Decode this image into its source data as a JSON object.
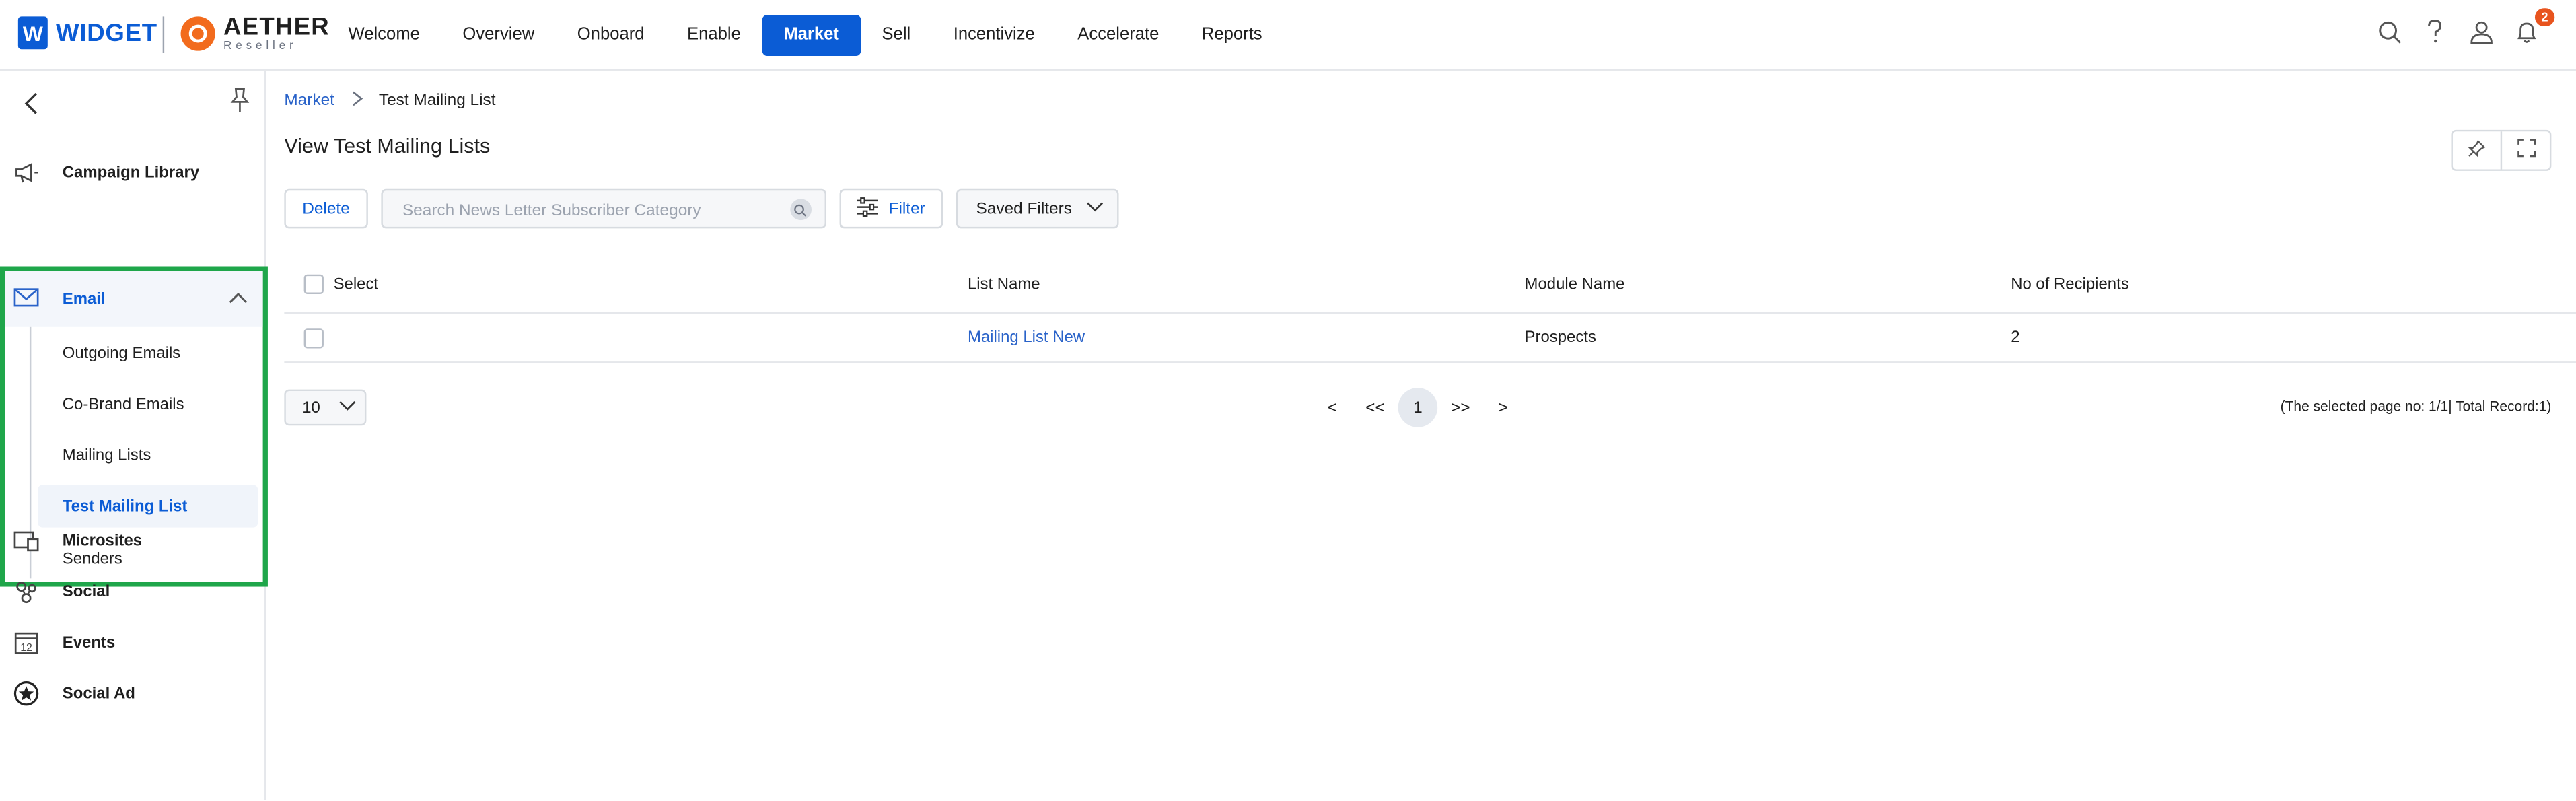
{
  "brand": {
    "widget_logo": "W",
    "widget_name": "WIDGET",
    "aether_name": "AETHER",
    "aether_sub": "Reseller"
  },
  "nav": [
    {
      "label": "Welcome"
    },
    {
      "label": "Overview"
    },
    {
      "label": "Onboard"
    },
    {
      "label": "Enable"
    },
    {
      "label": "Market"
    },
    {
      "label": "Sell"
    },
    {
      "label": "Incentivize"
    },
    {
      "label": "Accelerate"
    },
    {
      "label": "Reports"
    }
  ],
  "header_icons": {
    "notifications_count": "2"
  },
  "sidebar": {
    "items": [
      {
        "label": "Campaign Library",
        "icon": "megaphone-icon"
      },
      {
        "label": "Email",
        "icon": "envelope-icon"
      },
      {
        "label": "Microsites",
        "icon": "microsites-icon"
      },
      {
        "label": "Social",
        "icon": "social-icon"
      },
      {
        "label": "Events",
        "icon": "calendar-icon",
        "icon_text": "12"
      },
      {
        "label": "Social Ad",
        "icon": "star-badge-icon"
      }
    ],
    "email_sub": [
      {
        "label": "Outgoing Emails"
      },
      {
        "label": "Co-Brand Emails"
      },
      {
        "label": "Mailing Lists"
      },
      {
        "label": "Test Mailing List"
      },
      {
        "label": "Senders"
      }
    ]
  },
  "breadcrumb": {
    "parent": "Market",
    "current": "Test Mailing List"
  },
  "page": {
    "title": "View Test Mailing Lists"
  },
  "toolbar": {
    "delete_label": "Delete",
    "search_placeholder": "Search News Letter Subscriber Category",
    "filter_label": "Filter",
    "saved_filters_label": "Saved Filters"
  },
  "table": {
    "headers": {
      "select": "Select",
      "list_name": "List Name",
      "module_name": "Module Name",
      "recipients": "No of Recipients"
    },
    "rows": [
      {
        "list_name": "Mailing List New",
        "module_name": "Prospects",
        "recipients": "2"
      }
    ]
  },
  "pagination": {
    "page_size": "10",
    "prev": "<",
    "first": "<<",
    "current": "1",
    "last": ">>",
    "next": ">",
    "records_text": "(The selected page no: 1/1| Total Record:1)"
  },
  "colors": {
    "accent": "#0b5cd5",
    "highlight_border": "#1fa64a",
    "badge": "#e8541e",
    "brand_orange": "#f26b1d"
  }
}
